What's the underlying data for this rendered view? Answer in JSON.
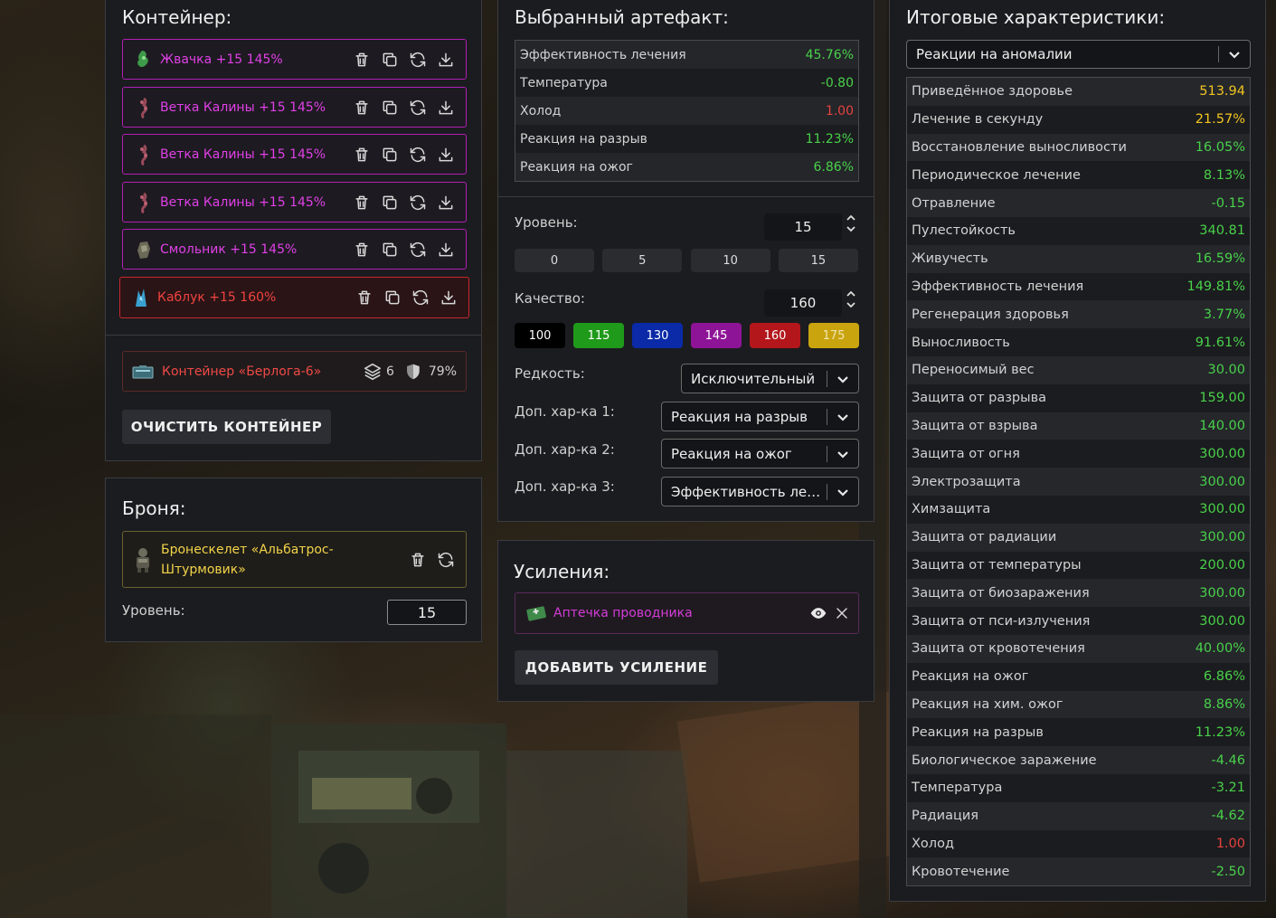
{
  "container": {
    "title": "Контейнер:",
    "items": [
      {
        "name": "Жвачка +15 145%",
        "icon": "gum-artifact-icon",
        "color": "#e040e6"
      },
      {
        "name": "Ветка Калины +15 145%",
        "icon": "branch-artifact-icon",
        "color": "#e040e6"
      },
      {
        "name": "Ветка Калины +15 145%",
        "icon": "branch-artifact-icon",
        "color": "#e040e6"
      },
      {
        "name": "Ветка Калины +15 145%",
        "icon": "branch-artifact-icon",
        "color": "#e040e6"
      },
      {
        "name": "Смольник +15 145%",
        "icon": "resin-artifact-icon",
        "color": "#e040e6"
      },
      {
        "name": "Каблук +15 160%",
        "icon": "heel-artifact-icon",
        "color": "#f0433f"
      }
    ],
    "container_name": "Контейнер «Берлога-6»",
    "slots": "6",
    "protection": "79%",
    "clear_button": "ОЧИСТИТЬ КОНТЕЙНЕР"
  },
  "armor": {
    "title": "Броня:",
    "name": "Бронескелет «Альбатрос-Штурмовик»",
    "level_label": "Уровень:",
    "level_value": "15"
  },
  "artifact": {
    "title": "Выбранный артефакт:",
    "stats": [
      {
        "label": "Эффективность лечения",
        "value": "45.76%",
        "tone": "green"
      },
      {
        "label": "Температура",
        "value": "-0.80",
        "tone": "green"
      },
      {
        "label": "Холод",
        "value": "1.00",
        "tone": "red"
      },
      {
        "label": "Реакция на разрыв",
        "value": "11.23%",
        "tone": "green"
      },
      {
        "label": "Реакция на ожог",
        "value": "6.86%",
        "tone": "green"
      }
    ],
    "level_label": "Уровень:",
    "level_value": "15",
    "level_presets": [
      "0",
      "5",
      "10",
      "15"
    ],
    "quality_label": "Качество:",
    "quality_value": "160",
    "quality_presets": [
      {
        "label": "100",
        "bg": "#000000",
        "fg": "#ffffff"
      },
      {
        "label": "115",
        "bg": "#1f9a1a",
        "fg": "#ffffff"
      },
      {
        "label": "130",
        "bg": "#0a2aa8",
        "fg": "#ffffff"
      },
      {
        "label": "145",
        "bg": "#8e1497",
        "fg": "#ffffff"
      },
      {
        "label": "160",
        "bg": "#b3171b",
        "fg": "#ffffff"
      },
      {
        "label": "175",
        "bg": "#c9a40e",
        "fg": "#f0e6b0"
      }
    ],
    "rarity_label": "Редкость:",
    "rarity_value": "Исключительный",
    "extra1_label": "Доп. хар-ка 1:",
    "extra1_value": "Реакция на разрыв",
    "extra2_label": "Доп. хар-ка 2:",
    "extra2_value": "Реакция на ожог",
    "extra3_label": "Доп. хар-ка 3:",
    "extra3_value": "Эффективность лечения"
  },
  "boosts": {
    "title": "Усиления:",
    "item": "Аптечка проводника",
    "add_button": "ДОБАВИТЬ УСИЛЕНИЕ"
  },
  "totals": {
    "title": "Итоговые характеристики:",
    "filter_value": "Реакции на аномалии",
    "rows": [
      {
        "label": "Приведённое здоровье",
        "value": "513.94",
        "tone": "yellow"
      },
      {
        "label": "Лечение в секунду",
        "value": "21.57%",
        "tone": "yellow"
      },
      {
        "label": "Восстановление выносливости",
        "value": "16.05%",
        "tone": "green"
      },
      {
        "label": "Периодическое лечение",
        "value": "8.13%",
        "tone": "green"
      },
      {
        "label": "Отравление",
        "value": "-0.15",
        "tone": "green"
      },
      {
        "label": "Пулестойкость",
        "value": "340.81",
        "tone": "green"
      },
      {
        "label": "Живучесть",
        "value": "16.59%",
        "tone": "green"
      },
      {
        "label": "Эффективность лечения",
        "value": "149.81%",
        "tone": "green"
      },
      {
        "label": "Регенерация здоровья",
        "value": "3.77%",
        "tone": "green"
      },
      {
        "label": "Выносливость",
        "value": "91.61%",
        "tone": "green"
      },
      {
        "label": "Переносимый вес",
        "value": "30.00",
        "tone": "green"
      },
      {
        "label": "Защита от разрыва",
        "value": "159.00",
        "tone": "green"
      },
      {
        "label": "Защита от взрыва",
        "value": "140.00",
        "tone": "green"
      },
      {
        "label": "Защита от огня",
        "value": "300.00",
        "tone": "green"
      },
      {
        "label": "Электрозащита",
        "value": "300.00",
        "tone": "green"
      },
      {
        "label": "Химзащита",
        "value": "300.00",
        "tone": "green"
      },
      {
        "label": "Защита от радиации",
        "value": "300.00",
        "tone": "green"
      },
      {
        "label": "Защита от температуры",
        "value": "200.00",
        "tone": "green"
      },
      {
        "label": "Защита от биозаражения",
        "value": "300.00",
        "tone": "green"
      },
      {
        "label": "Защита от пси-излучения",
        "value": "300.00",
        "tone": "green"
      },
      {
        "label": "Защита от кровотечения",
        "value": "40.00%",
        "tone": "green"
      },
      {
        "label": "Реакция на ожог",
        "value": "6.86%",
        "tone": "green"
      },
      {
        "label": "Реакция на хим. ожог",
        "value": "8.86%",
        "tone": "green"
      },
      {
        "label": "Реакция на разрыв",
        "value": "11.23%",
        "tone": "green"
      },
      {
        "label": "Биологическое заражение",
        "value": "-4.46",
        "tone": "green"
      },
      {
        "label": "Температура",
        "value": "-3.21",
        "tone": "green"
      },
      {
        "label": "Радиация",
        "value": "-4.62",
        "tone": "green"
      },
      {
        "label": "Холод",
        "value": "1.00",
        "tone": "red"
      },
      {
        "label": "Кровотечение",
        "value": "-2.50",
        "tone": "green"
      }
    ]
  }
}
